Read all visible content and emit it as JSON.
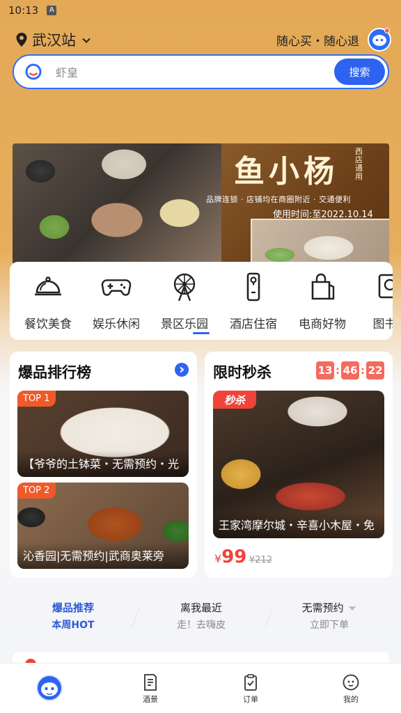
{
  "status_bar": {
    "time": "10:13",
    "badge": "A"
  },
  "location": {
    "name": "武汉站",
    "slogan": "随心买・随心退"
  },
  "search": {
    "placeholder": "虾皇",
    "button_label": "搜索"
  },
  "banner": {
    "title": "鱼小杨",
    "side_text": "西店通用",
    "subtitle": "品牌连锁 · 店铺均在商圈附近 · 交通便利",
    "date_text": "使用时间:至2022.10.14"
  },
  "categories": [
    {
      "label": "餐饮美食",
      "icon": "cloche-icon"
    },
    {
      "label": "娱乐休闲",
      "icon": "gamepad-icon"
    },
    {
      "label": "景区乐园",
      "icon": "ferris-wheel-icon"
    },
    {
      "label": "酒店住宿",
      "icon": "door-hanger-icon"
    },
    {
      "label": "电商好物",
      "icon": "shopping-bag-icon"
    },
    {
      "label": "图书频",
      "icon": "book-search-icon"
    }
  ],
  "hot_rank": {
    "title": "爆品排行榜",
    "items": [
      {
        "badge": "TOP 1",
        "caption": "【爷爷的土钵菜・无需预约・光"
      },
      {
        "badge": "TOP 2",
        "caption": "沁香园|无需预约|武商奥莱旁"
      }
    ]
  },
  "flash_sale": {
    "title": "限时秒杀",
    "timer": {
      "h": "13",
      "m": "46",
      "s": "22"
    },
    "badge": "秒杀",
    "caption": "王家湾摩尔城・辛喜小木屋・免",
    "currency": "¥",
    "price": "99",
    "original_price": "¥212"
  },
  "tabs": [
    {
      "main": "爆品推荐",
      "sub": "本周HOT",
      "active": true
    },
    {
      "main": "离我最近",
      "sub": "走！去嗨皮",
      "active": false
    },
    {
      "main": "无需预约",
      "sub": "立即下单",
      "active": false
    }
  ],
  "bottom_nav": [
    {
      "label": "",
      "icon": "home-mascot-icon"
    },
    {
      "label": "酒景",
      "icon": "receipt-icon"
    },
    {
      "label": "订单",
      "icon": "order-clipboard-icon"
    },
    {
      "label": "我的",
      "icon": "profile-icon"
    }
  ],
  "colors": {
    "accent": "#2d63f0",
    "sale_red": "#f0433a",
    "header_bg": "#e3a957"
  }
}
